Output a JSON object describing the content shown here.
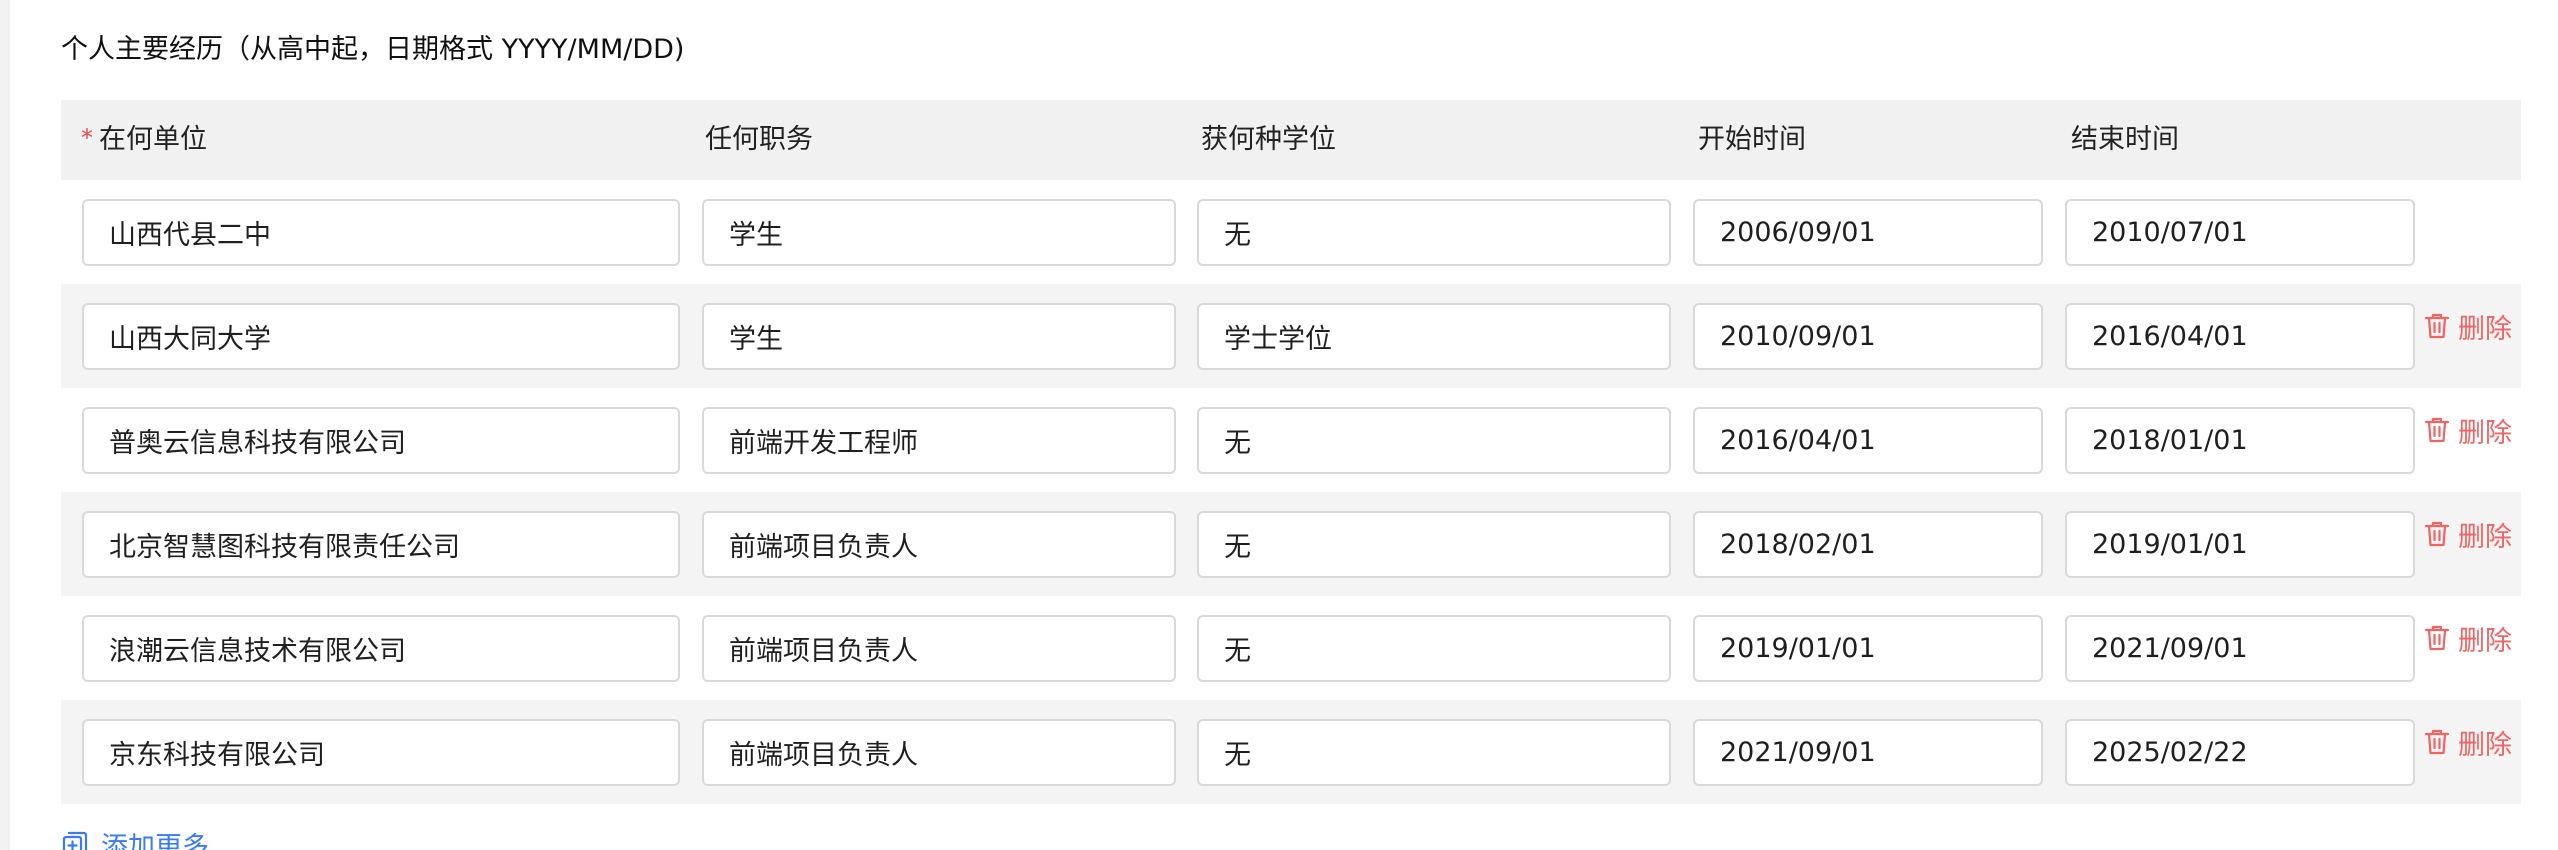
{
  "section": {
    "title": "个人主要经历（从高中起，日期格式 YYYY/MM/DD)"
  },
  "table": {
    "required_mark": "*",
    "headers": {
      "unit": "在何单位",
      "position": "任何职务",
      "degree": "获何种学位",
      "start": "开始时间",
      "end": "结束时间"
    },
    "delete_label": "删除",
    "rows": [
      {
        "unit": "山西代县二中",
        "position": "学生",
        "degree": "无",
        "start": "2006/09/01",
        "end": "2010/07/01"
      },
      {
        "unit": "山西大同大学",
        "position": "学生",
        "degree": "学士学位",
        "start": "2010/09/01",
        "end": "2016/04/01"
      },
      {
        "unit": "普奥云信息科技有限公司",
        "position": "前端开发工程师",
        "degree": "无",
        "start": "2016/04/01",
        "end": "2018/01/01"
      },
      {
        "unit": "北京智慧图科技有限责任公司",
        "position": "前端项目负责人",
        "degree": "无",
        "start": "2018/02/01",
        "end": "2019/01/01"
      },
      {
        "unit": "浪潮云信息技术有限公司",
        "position": "前端项目负责人",
        "degree": "无",
        "start": "2019/01/01",
        "end": "2021/09/01"
      },
      {
        "unit": "京东科技有限公司",
        "position": "前端项目负责人",
        "degree": "无",
        "start": "2021/09/01",
        "end": "2025/02/22"
      }
    ]
  },
  "actions": {
    "add_more_label": "添加更多"
  },
  "colors": {
    "danger": "#ef6363",
    "link": "#3a7bf5",
    "header_bg": "#f1f1f1",
    "row_alt_bg": "#f4f4f4",
    "border": "#d9d9d9"
  },
  "icons": {
    "delete": "trash-icon",
    "add": "add-copy-icon"
  }
}
